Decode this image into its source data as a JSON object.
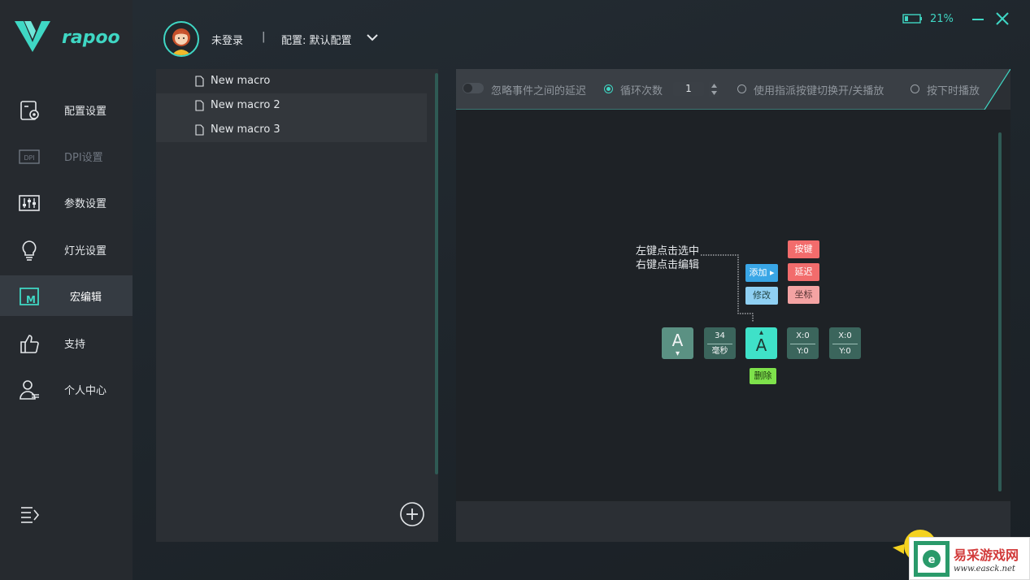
{
  "app": {
    "brand": "rapoo"
  },
  "header": {
    "login_status": "未登录",
    "separator": "|",
    "config_label": "配置: 默认配置",
    "battery_percent": "21%"
  },
  "sidebar": {
    "items": [
      {
        "label": "配置设置",
        "icon": "config-icon"
      },
      {
        "label": "DPI设置",
        "icon": "dpi-icon",
        "disabled": true
      },
      {
        "label": "参数设置",
        "icon": "sliders-icon"
      },
      {
        "label": "灯光设置",
        "icon": "bulb-icon"
      },
      {
        "label": "宏编辑",
        "icon": "macro-icon",
        "active": true
      },
      {
        "label": "支持",
        "icon": "thumbs-up-icon"
      },
      {
        "label": "个人中心",
        "icon": "user-icon"
      }
    ]
  },
  "macros": {
    "items": [
      "New macro",
      "New macro 2",
      "New macro 3"
    ]
  },
  "options": {
    "ignore_delay": "忽略事件之间的延迟",
    "loop_count_label": "循环次数",
    "loop_count_value": "1",
    "toggle_mode": "使用指派按键切换开/关播放",
    "hold_mode": "按下时播放"
  },
  "help": {
    "line1": "左键点击选中",
    "line2": "右键点击编辑",
    "add": "添加",
    "modify": "修改",
    "key": "按键",
    "delay": "延迟",
    "coord": "坐标",
    "delete": "删除"
  },
  "steps": {
    "key1": "A",
    "delay_value": "34",
    "delay_unit": "毫秒",
    "key2": "A",
    "coord1_x": "X:0",
    "coord1_y": "Y:0",
    "coord2_x": "X:0",
    "coord2_y": "Y:0"
  },
  "watermark": {
    "title": "易采游戏网",
    "url": "www.easck.net"
  },
  "colors": {
    "accent": "#3fd7c4",
    "sidebar": "#262a2f",
    "panel": "#2b2f34"
  }
}
